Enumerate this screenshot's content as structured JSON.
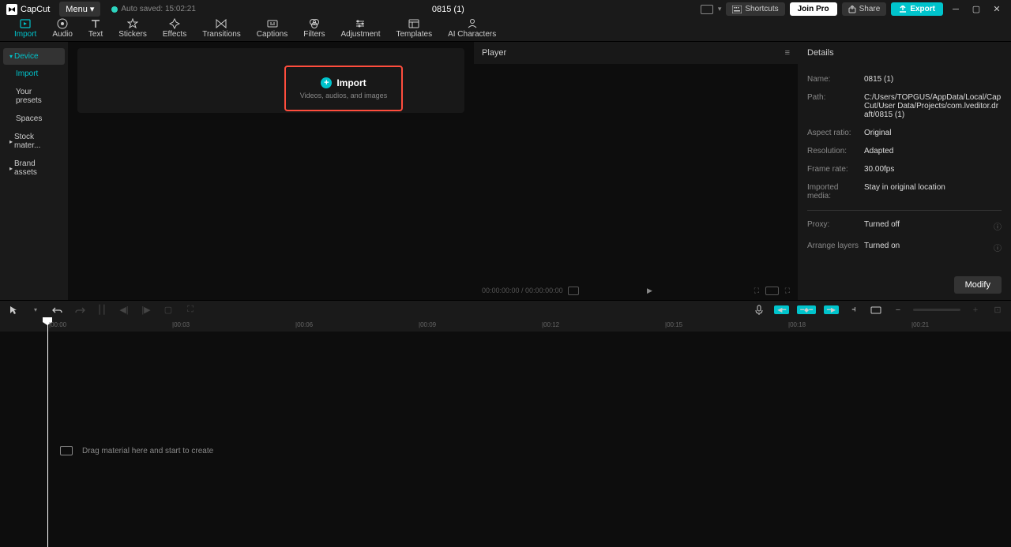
{
  "titlebar": {
    "logo": "CapCut",
    "menu": "Menu",
    "autosave": "Auto saved: 15:02:21",
    "project_title": "0815 (1)",
    "shortcuts": "Shortcuts",
    "joinpro": "Join Pro",
    "share": "Share",
    "export": "Export"
  },
  "tool_tabs": [
    {
      "label": "Import",
      "active": true
    },
    {
      "label": "Audio"
    },
    {
      "label": "Text"
    },
    {
      "label": "Stickers"
    },
    {
      "label": "Effects"
    },
    {
      "label": "Transitions"
    },
    {
      "label": "Captions"
    },
    {
      "label": "Filters"
    },
    {
      "label": "Adjustment"
    },
    {
      "label": "Templates"
    },
    {
      "label": "AI Characters"
    }
  ],
  "sidebar": {
    "device": "Device",
    "import": "Import",
    "presets": "Your presets",
    "spaces": "Spaces",
    "stock": "Stock mater...",
    "brand": "Brand assets"
  },
  "import_box": {
    "title": "Import",
    "subtitle": "Videos, audios, and images"
  },
  "player": {
    "title": "Player",
    "timecode": "00:00:00:00 / 00:00:00:00"
  },
  "details": {
    "title": "Details",
    "rows": {
      "name_label": "Name:",
      "name_value": "0815 (1)",
      "path_label": "Path:",
      "path_value": "C:/Users/TOPGUS/AppData/Local/CapCut/User Data/Projects/com.lveditor.draft/0815 (1)",
      "aspect_label": "Aspect ratio:",
      "aspect_value": "Original",
      "resolution_label": "Resolution:",
      "resolution_value": "Adapted",
      "framerate_label": "Frame rate:",
      "framerate_value": "30.00fps",
      "imported_label": "Imported media:",
      "imported_value": "Stay in original location",
      "proxy_label": "Proxy:",
      "proxy_value": "Turned off",
      "arrange_label": "Arrange layers",
      "arrange_value": "Turned on"
    },
    "modify": "Modify"
  },
  "timeline": {
    "marks": [
      "|00:00",
      "|00:03",
      "|00:06",
      "|00:09",
      "|00:12",
      "|00:15",
      "|00:18",
      "|00:21"
    ],
    "drag_hint": "Drag material here and start to create"
  }
}
